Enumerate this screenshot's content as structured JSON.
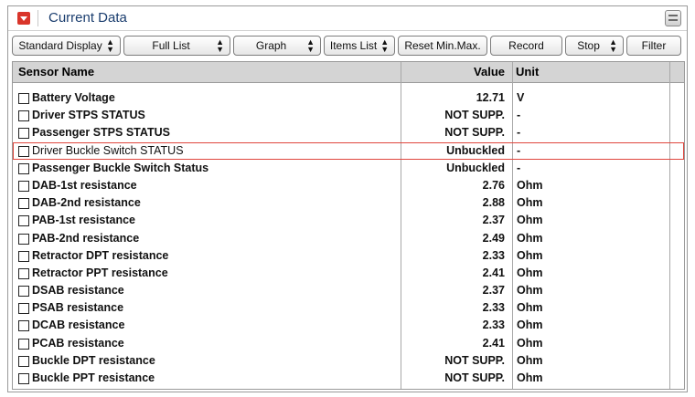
{
  "window": {
    "title": "Current Data",
    "accent": "#d9352a",
    "title_color": "#1a3d6e"
  },
  "toolbar": {
    "standard_display": "Standard Display",
    "full_list": "Full List",
    "graph": "Graph",
    "items_list": "Items List",
    "reset": "Reset Min.Max.",
    "record": "Record",
    "stop": "Stop",
    "filter": "Filter"
  },
  "table": {
    "headers": {
      "name": "Sensor Name",
      "value": "Value",
      "unit": "Unit"
    },
    "highlight_color": "#e0463d",
    "rows": [
      {
        "name": "Battery Voltage",
        "value": "12.71",
        "unit": "V"
      },
      {
        "name": "Driver STPS STATUS",
        "value": "NOT SUPP.",
        "unit": "-"
      },
      {
        "name": "Passenger STPS STATUS",
        "value": "NOT SUPP.",
        "unit": "-"
      },
      {
        "name": "Driver Buckle Switch STATUS",
        "value": "Unbuckled",
        "unit": "-"
      },
      {
        "name": "Passenger Buckle Switch Status",
        "value": "Unbuckled",
        "unit": "-"
      },
      {
        "name": "DAB-1st resistance",
        "value": "2.76",
        "unit": "Ohm"
      },
      {
        "name": "DAB-2nd resistance",
        "value": "2.88",
        "unit": "Ohm"
      },
      {
        "name": "PAB-1st resistance",
        "value": "2.37",
        "unit": "Ohm"
      },
      {
        "name": "PAB-2nd resistance",
        "value": "2.49",
        "unit": "Ohm"
      },
      {
        "name": "Retractor DPT resistance",
        "value": "2.33",
        "unit": "Ohm"
      },
      {
        "name": "Retractor PPT resistance",
        "value": "2.41",
        "unit": "Ohm"
      },
      {
        "name": "DSAB resistance",
        "value": "2.37",
        "unit": "Ohm"
      },
      {
        "name": "PSAB resistance",
        "value": "2.33",
        "unit": "Ohm"
      },
      {
        "name": "DCAB resistance",
        "value": "2.33",
        "unit": "Ohm"
      },
      {
        "name": "PCAB resistance",
        "value": "2.41",
        "unit": "Ohm"
      },
      {
        "name": "Buckle DPT resistance",
        "value": "NOT SUPP.",
        "unit": "Ohm"
      },
      {
        "name": "Buckle PPT resistance",
        "value": "NOT SUPP.",
        "unit": "Ohm"
      }
    ]
  }
}
